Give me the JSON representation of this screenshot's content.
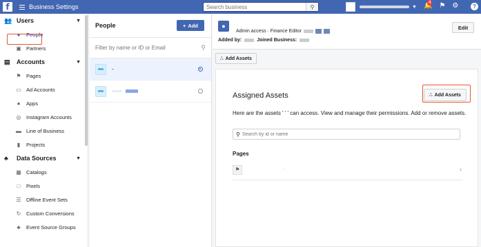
{
  "topbar": {
    "logo": "f",
    "title": "Business Settings",
    "search_placeholder": "Search business",
    "search_icon": "search-icon",
    "notif_count": "4",
    "help": "?"
  },
  "sidebar": {
    "sections": [
      {
        "label": "Users",
        "icon": "users-icon",
        "items": [
          {
            "label": "People",
            "icon": "person-icon",
            "active": true
          },
          {
            "label": "Partners",
            "icon": "partners-icon"
          }
        ]
      },
      {
        "label": "Accounts",
        "icon": "accounts-icon",
        "items": [
          {
            "label": "Pages",
            "icon": "flag-icon"
          },
          {
            "label": "Ad Accounts",
            "icon": "ad-account-icon"
          },
          {
            "label": "Apps",
            "icon": "apps-icon"
          },
          {
            "label": "Instagram Accounts",
            "icon": "instagram-icon"
          },
          {
            "label": "Line of Business",
            "icon": "line-of-business-icon"
          },
          {
            "label": "Projects",
            "icon": "projects-icon"
          }
        ]
      },
      {
        "label": "Data Sources",
        "icon": "data-sources-icon",
        "items": [
          {
            "label": "Catalogs",
            "icon": "catalog-icon"
          },
          {
            "label": "Pixels",
            "icon": "pixel-icon"
          },
          {
            "label": "Offline Event Sets",
            "icon": "offline-events-icon"
          },
          {
            "label": "Custom Conversions",
            "icon": "custom-conversions-icon"
          },
          {
            "label": "Event Source Groups",
            "icon": "event-source-groups-icon"
          }
        ]
      }
    ]
  },
  "people": {
    "title": "People",
    "add_label": "Add",
    "filter_placeholder": "Filter by name or ID or Email",
    "rows": [
      {
        "name": "-",
        "selected": true
      },
      {
        "name": "",
        "selected": false
      }
    ]
  },
  "detail": {
    "role_text": "Admin access · Finance Editor",
    "added_by_label": "Added by:",
    "joined_label": "Joined Business:",
    "edit_label": "Edit",
    "add_assets_label": "Add Assets",
    "card": {
      "title": "Assigned Assets",
      "add_assets_label": "Add Assets",
      "description": "Here are the assets ' ' ' can access. View and manage their permissions. Add or remove assets.",
      "search_placeholder": "Search by id or name",
      "pages_label": "Pages",
      "page_name": "·"
    }
  },
  "colors": {
    "brand": "#4267b2",
    "highlight": "#e8562a"
  }
}
